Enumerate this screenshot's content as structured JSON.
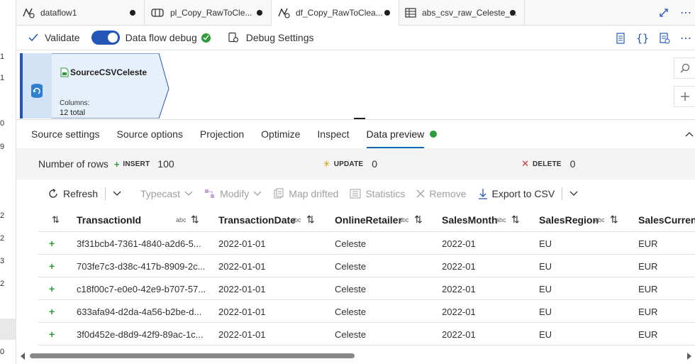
{
  "gutter": [
    "1",
    "1",
    "0",
    "9",
    "2",
    "2",
    "3",
    "2",
    "0"
  ],
  "tabs": [
    {
      "label": "dataflow1",
      "icon": "dataflow-icon",
      "active": false
    },
    {
      "label": "pl_Copy_RawToCle...",
      "icon": "pipeline-icon",
      "active": false
    },
    {
      "label": "df_Copy_RawToClea...",
      "icon": "dataflow-icon",
      "active": true
    },
    {
      "label": "abs_csv_raw_Celeste_...",
      "icon": "table-icon",
      "active": false
    }
  ],
  "toolbar": {
    "validate": "Validate",
    "debug": "Data flow debug",
    "debug_settings": "Debug Settings"
  },
  "node": {
    "title": "SourceCSVCeleste",
    "columns_label": "Columns:",
    "columns_value": "12 total"
  },
  "panel_tabs": [
    "Source settings",
    "Source options",
    "Projection",
    "Optimize",
    "Inspect",
    "Data preview"
  ],
  "summary": {
    "label": "Number of rows",
    "insert_label": "INSERT",
    "insert_value": "100",
    "update_label": "UPDATE",
    "update_value": "0",
    "delete_label": "DELETE",
    "delete_value": "0"
  },
  "data_toolbar": {
    "refresh": "Refresh",
    "typecast": "Typecast",
    "modify": "Modify",
    "map_drifted": "Map drifted",
    "statistics": "Statistics",
    "remove": "Remove",
    "export": "Export to CSV"
  },
  "columns": [
    "TransactionId",
    "TransactionDate",
    "OnlineRetailer",
    "SalesMonth",
    "SalesRegion",
    "SalesCurrenc"
  ],
  "abc": "abc",
  "rows": [
    [
      "3f31bcb4-7361-4840-a2d6-5...",
      "2022-01-01",
      "Celeste",
      "2022-01",
      "EU",
      "EUR"
    ],
    [
      "703fe7c3-d38c-417b-8909-2c...",
      "2022-01-01",
      "Celeste",
      "2022-01",
      "EU",
      "EUR"
    ],
    [
      "c18f00c7-e0e0-42e9-b707-57...",
      "2022-01-01",
      "Celeste",
      "2022-01",
      "EU",
      "EUR"
    ],
    [
      "633afa94-d2da-4a56-b2be-d...",
      "2022-01-01",
      "Celeste",
      "2022-01",
      "EU",
      "EUR"
    ],
    [
      "3f0d452e-d8d9-42f9-89ac-1c...",
      "2022-01-01",
      "Celeste",
      "2022-01",
      "EU",
      "EUR"
    ]
  ],
  "colors": {
    "accent": "#2456b8",
    "success": "#2f9a3a",
    "delete": "#d13438",
    "update": "#c19c00"
  }
}
